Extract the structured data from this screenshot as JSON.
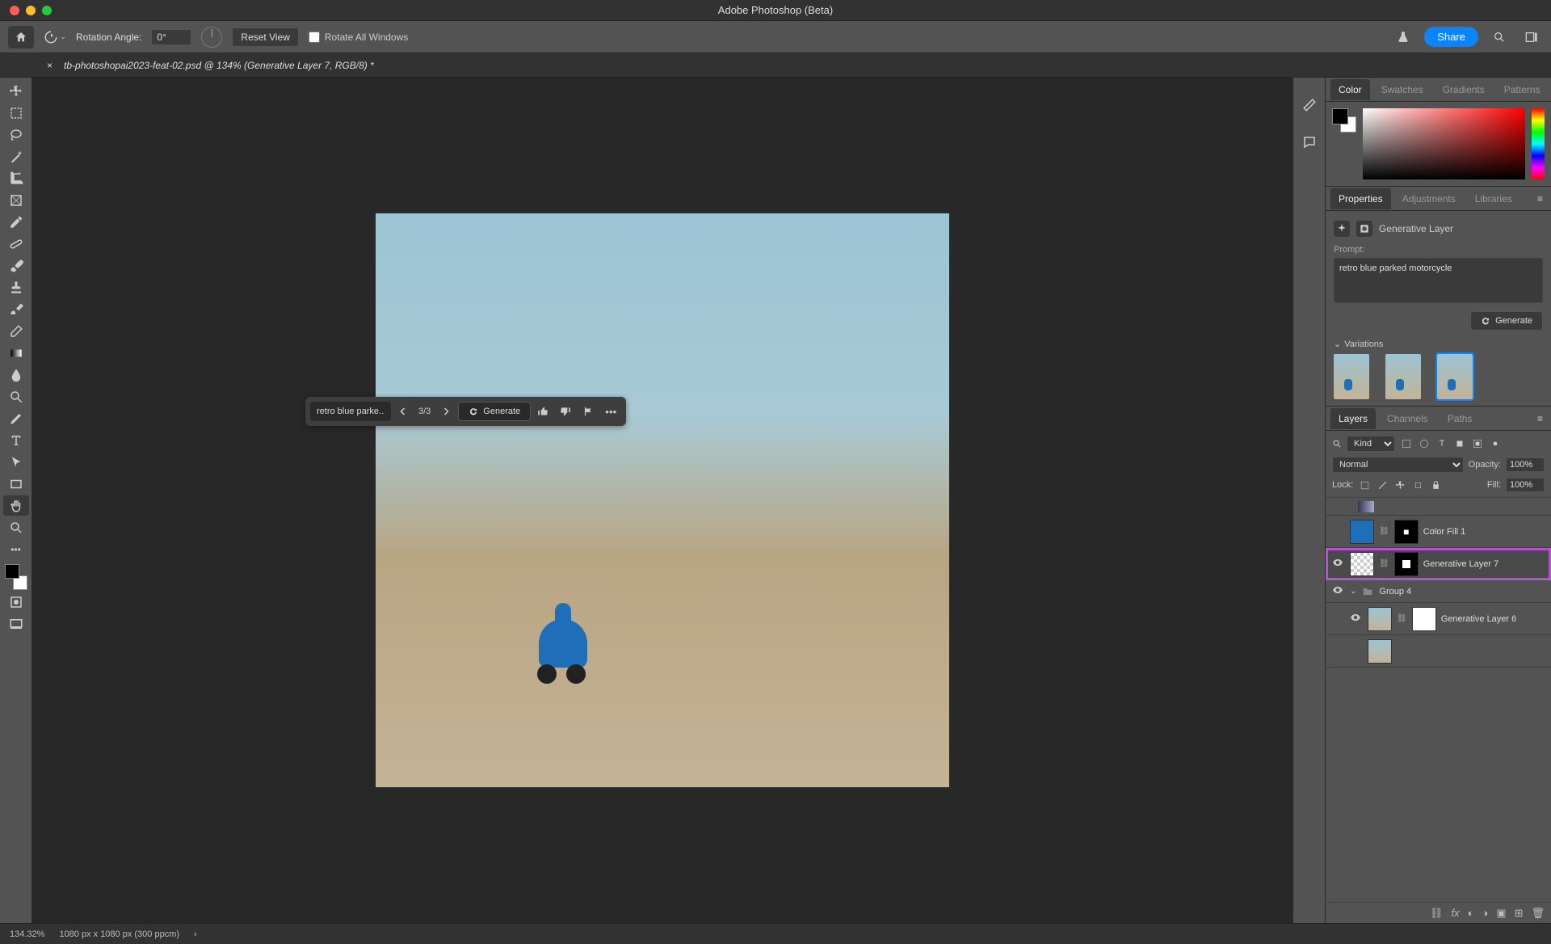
{
  "titlebar": {
    "title": "Adobe Photoshop (Beta)"
  },
  "optionsbar": {
    "rotation_label": "Rotation Angle:",
    "rotation_value": "0°",
    "reset_view": "Reset View",
    "rotate_all": "Rotate All Windows",
    "share": "Share"
  },
  "doctab": {
    "title": "tb-photoshopai2023-feat-02.psd @ 134% (Generative Layer 7, RGB/8) *"
  },
  "taskbar": {
    "prompt": "retro blue parke...",
    "count": "3/3",
    "generate": "Generate"
  },
  "color_tabs": [
    "Color",
    "Swatches",
    "Gradients",
    "Patterns"
  ],
  "props_tabs": [
    "Properties",
    "Adjustments",
    "Libraries"
  ],
  "properties": {
    "type": "Generative Layer",
    "prompt_label": "Prompt:",
    "prompt_value": "retro blue parked motorcycle",
    "generate": "Generate",
    "variations_label": "Variations"
  },
  "layers_tabs": [
    "Layers",
    "Channels",
    "Paths"
  ],
  "layers_controls": {
    "filter": "Kind",
    "blend": "Normal",
    "opacity_label": "Opacity:",
    "opacity_value": "100%",
    "lock_label": "Lock:",
    "fill_label": "Fill:",
    "fill_value": "100%"
  },
  "layers": [
    {
      "name": "Color Fill 1"
    },
    {
      "name": "Generative Layer 7"
    },
    {
      "name": "Group 4"
    },
    {
      "name": "Generative Layer 6"
    }
  ],
  "statusbar": {
    "zoom": "134.32%",
    "dims": "1080 px x 1080 px (300 ppcm)"
  }
}
